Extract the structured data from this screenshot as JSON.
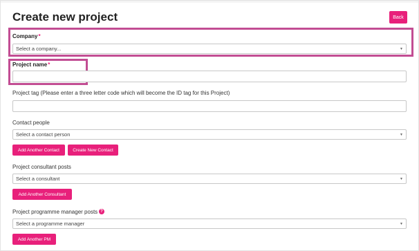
{
  "page": {
    "title": "Create new project",
    "back_label": "Back"
  },
  "company": {
    "label": "Company",
    "required_mark": "*",
    "placeholder": "Select a company..."
  },
  "project_name": {
    "label": "Project name",
    "required_mark": "*",
    "value": ""
  },
  "project_tag": {
    "label": "Project tag (Please enter a three letter code which will become the ID tag for this Project)",
    "value": ""
  },
  "contact_people": {
    "label": "Contact people",
    "placeholder": "Select a contact person",
    "add_button": "Add Another Contact",
    "create_button": "Create New Contact"
  },
  "consultant": {
    "label": "Project consultant posts",
    "placeholder": "Select a consultant",
    "add_button": "Add Another Consultant"
  },
  "programme_manager": {
    "label": "Project programme manager posts",
    "placeholder": "Select a programme manager",
    "add_button": "Add Another PM",
    "help_icon": "question-circle-icon"
  },
  "colors": {
    "accent": "#e8207b",
    "highlight": "#c24d93"
  }
}
